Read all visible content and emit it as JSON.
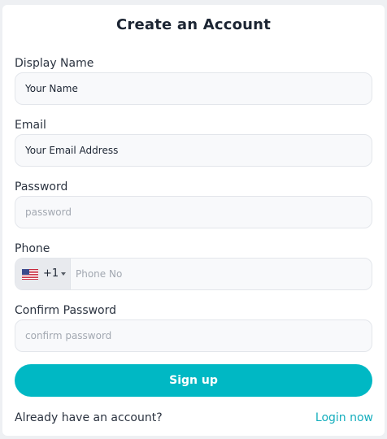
{
  "form": {
    "title": "Create an Account",
    "display_name": {
      "label": "Display Name",
      "value": "Your Name"
    },
    "email": {
      "label": "Email",
      "value": "Your Email Address"
    },
    "password": {
      "label": "Password",
      "placeholder": "password"
    },
    "phone": {
      "label": "Phone",
      "country_flag_icon": "us-flag-icon",
      "dial_code": "+1",
      "placeholder": "Phone No"
    },
    "confirm_password": {
      "label": "Confirm Password",
      "placeholder": "confirm password"
    },
    "submit_label": "Sign up",
    "footer": {
      "prompt": "Already have an account?",
      "login_link": "Login now"
    }
  },
  "colors": {
    "accent": "#00b8c4",
    "link": "#15aebd",
    "field_bg": "#f8f9fb",
    "page_bg": "#eef0f3"
  }
}
